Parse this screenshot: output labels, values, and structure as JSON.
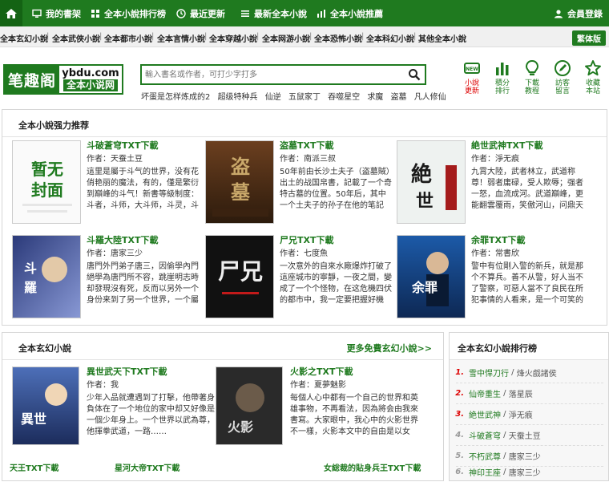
{
  "topnav": {
    "items": [
      "我的書架",
      "全本小說排行榜",
      "最近更新",
      "最新全本小說",
      "全本小說推薦"
    ],
    "login": "会員登錄"
  },
  "categories": {
    "items": [
      "全本玄幻小說",
      "全本武俠小說",
      "全本都市小說",
      "全本言情小說",
      "全本穿越小說",
      "全本网游小說",
      "全本恐怖小說",
      "全本科幻小說",
      "其他全本小說"
    ],
    "traditional": "繁体版"
  },
  "logo": {
    "cn": "笔趣阁",
    "domain": "ybdu.com",
    "sub": "全本小说网"
  },
  "search": {
    "placeholder": "輸入書名或作者，可打少字打多"
  },
  "hotwords": [
    "坏蛋是怎样炼成的2",
    "超级特种兵",
    "仙逆",
    "五鼠家丁",
    "吞噬星空",
    "求魔",
    "盗墓",
    "凡人修仙"
  ],
  "tools": [
    {
      "label1": "小說",
      "label2": "更新"
    },
    {
      "label1": "積分",
      "label2": "排行"
    },
    {
      "label1": "下載",
      "label2": "教程"
    },
    {
      "label1": "訪客",
      "label2": "留言"
    },
    {
      "label1": "收藏",
      "label2": "本站"
    }
  ],
  "recommend": {
    "title": "全本小說强力推荐",
    "books": [
      {
        "title": "斗破蒼穹TXT下載",
        "author": "作者：天蚕土豆",
        "desc": "這里是屬于斗气的世界，没有花俏艳丽的魔法，有的，僅是繁衍到巔峰的斗气！新書等級制度：斗者，斗师，大斗师，斗灵，斗王……"
      },
      {
        "title": "盗墓TXT下載",
        "author": "作者：南派三叔",
        "desc": "50年前由长沙土夫子（盗墓賊）出土的战国帛書，記載了一个奇特古墓的位置。50年后，其中一个土夫子的孙子在他的笔記中……"
      },
      {
        "title": "絶世武神TXT下載",
        "author": "作者：淨无痕",
        "desc": "九霄大陸，武者林立，武道称尊！弱者庸碌，受人欺辱；强者一怒，血流成河。武道巔峰，更能翻雲覆雨，笑傲河山，问鼎天下……"
      },
      {
        "title": "斗羅大陸TXT下載",
        "author": "作者：唐家三少",
        "desc": "唐門外門弟子唐三，因偷學內門絕學為唐門所不容，跳崖明志時却發現沒有死，反而以另外一个身份来到了另一个世界，一个屬于武魂的世界。名叫斗羅大陸。這里没有魔……"
      },
      {
        "title": "尸兄TXT下載",
        "author": "作者：七度魚",
        "desc": "一次意外的自來水廠爆炸打破了這座城市的寧靜，一夜之間，變成了一个个怪物，在这危機四伏的都市中，我一定要把握好機會……"
      },
      {
        "title": "余罪TXT下載",
        "author": "作者：常書欣",
        "desc": "警中有位剛入警的新兵，就是那个不算兵。善不从警，好人当不了警察，可惡人當不了良民在所犯事情的人看来，是一个可笑的情報。"
      }
    ]
  },
  "xuanhuan": {
    "title": "全本玄幻小說",
    "more": "更多免費玄幻小說>>",
    "books": [
      {
        "title": "異世武天下TXT下載",
        "author": "作者：我",
        "desc": "少年入品就遭遇到了打擊，他帶著身負体在了一个地位的家中却又好像是一個少年身上。一个世界以武為尊，他揮拳武道，一路……"
      },
      {
        "title": "火影之TXT下載",
        "author": "作者：夏夢魅影",
        "desc": "每個人心中都有一个自己的世界和英雄事物，不再看法，因為將会由我來書寫。大家眼中，我心中的火影世界不一樣，火影本文中的自由是以女性……"
      }
    ],
    "extras": [
      "天王TXT下載",
      "星河大帝TXT下載",
      "女総裁的貼身兵王TXT下載"
    ]
  },
  "ranking": {
    "title": "全本玄幻小說排行榜",
    "items": [
      {
        "num": "1.",
        "title": "雪中悍刀行",
        "author": "烽火戲諸侯"
      },
      {
        "num": "2.",
        "title": "仙帝重生",
        "author": "落星辰"
      },
      {
        "num": "3.",
        "title": "絶世武神",
        "author": "淨无痕"
      },
      {
        "num": "4.",
        "title": "斗破蒼穹",
        "author": "天蚕土豆"
      },
      {
        "num": "5.",
        "title": "不朽武尊",
        "author": "唐家三少"
      },
      {
        "num": "6.",
        "title": "神印王座",
        "author": "唐家三少"
      }
    ]
  },
  "colors": {
    "brand": "#1f7a1f",
    "accent_red": "#d00000"
  }
}
